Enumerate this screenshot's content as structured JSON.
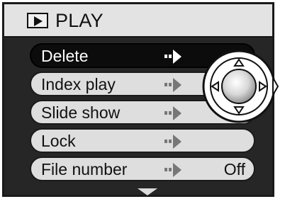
{
  "header": {
    "title": "PLAY",
    "icon": "play-icon"
  },
  "menu": {
    "items": [
      {
        "label": "Delete",
        "value": "",
        "selected": true
      },
      {
        "label": "Index play",
        "value": "",
        "selected": false
      },
      {
        "label": "Slide show",
        "value": "",
        "selected": false
      },
      {
        "label": "Lock",
        "value": "",
        "selected": false
      },
      {
        "label": "File number",
        "value": "Off",
        "selected": false
      }
    ]
  },
  "colors": {
    "screen_bg": "#262626",
    "item_bg": "#dedede",
    "selected_bg": "#0c0c0c",
    "header_bg": "#e3e3e3"
  },
  "icons": [
    "play-icon",
    "submenu-arrow-icon",
    "scroll-down-icon",
    "controller-dial-icon"
  ]
}
